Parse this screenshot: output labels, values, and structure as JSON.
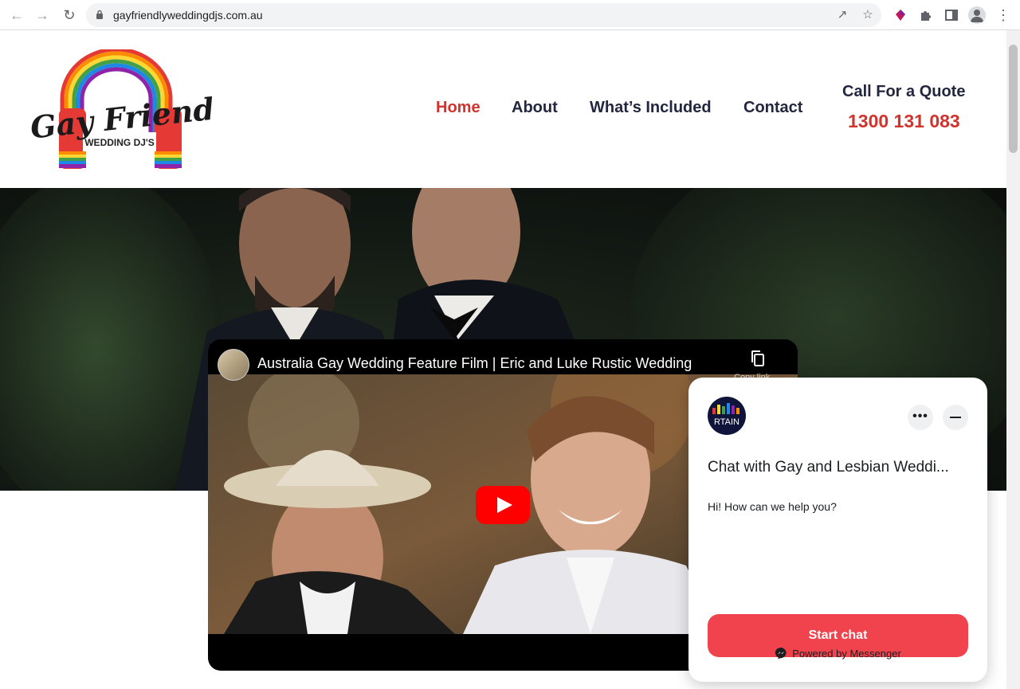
{
  "browser": {
    "url": "gayfriendlyweddingdjs.com.au",
    "icons": [
      "back-icon",
      "forward-icon",
      "reload-icon",
      "lock-icon",
      "share-icon",
      "star-icon",
      "extension-icon",
      "puzzle-icon",
      "sidepanel-icon",
      "profile-icon",
      "menu-icon"
    ]
  },
  "header": {
    "logo": {
      "script_text": "Gay Friendly",
      "subtitle": "WEDDING DJ'S"
    },
    "nav": [
      {
        "label": "Home",
        "active": true
      },
      {
        "label": "About",
        "active": false
      },
      {
        "label": "What’s Included",
        "active": false
      },
      {
        "label": "Contact",
        "active": false
      }
    ],
    "quote": {
      "label": "Call For a Quote",
      "phone": "1300 131 083"
    }
  },
  "video": {
    "title": "Australia Gay Wedding Feature Film | Eric and Luke Rustic Wedding",
    "copy_label": "Copy link"
  },
  "chat": {
    "avatar_text": "RTAIN",
    "title": "Chat with Gay and Lesbian Weddi...",
    "message": "Hi! How can we help you?",
    "start_label": "Start chat",
    "powered_by": "Powered by Messenger"
  },
  "colors": {
    "accent": "#d0342c",
    "nav_text": "#23263f",
    "chat_button": "#f0434d"
  }
}
